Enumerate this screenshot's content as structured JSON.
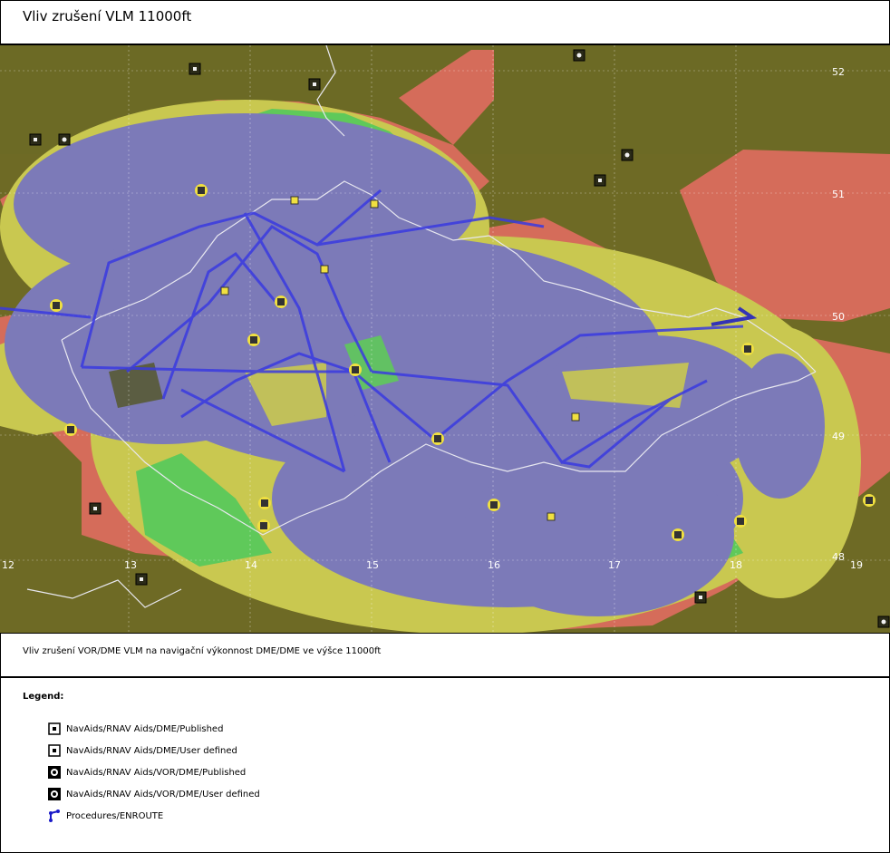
{
  "title": "Vliv zrušení VLM 11000ft",
  "caption": "Vliv zrušení VOR/DME VLM na navigační výkonnost DME/DME ve výšce 11000ft",
  "map": {
    "longitude_labels": [
      "12",
      "13",
      "14",
      "15",
      "16",
      "17",
      "18",
      "19"
    ],
    "latitude_labels": [
      "52",
      "51",
      "50",
      "49",
      "48"
    ],
    "colors": {
      "terrain": "#6e6a25",
      "coverage_blue": "#7c7ab8",
      "coverage_yellow": "#c9c850",
      "coverage_green": "#5fc95a",
      "coverage_red": "#d56c5a",
      "border": "#e8e8f0",
      "route": "#3a3ae0"
    }
  },
  "legend": {
    "title": "Legend:",
    "items": [
      {
        "label": "NavAids/RNAV Aids/DME/Published",
        "icon": "dme-published-icon"
      },
      {
        "label": "NavAids/RNAV Aids/DME/User defined",
        "icon": "dme-user-defined-icon"
      },
      {
        "label": "NavAids/RNAV Aids/VOR/DME/Published",
        "icon": "vor-dme-published-icon"
      },
      {
        "label": "NavAids/RNAV Aids/VOR/DME/User defined",
        "icon": "vor-dme-user-defined-icon"
      },
      {
        "label": "Procedures/ENROUTE",
        "icon": "enroute-procedure-icon"
      }
    ]
  }
}
